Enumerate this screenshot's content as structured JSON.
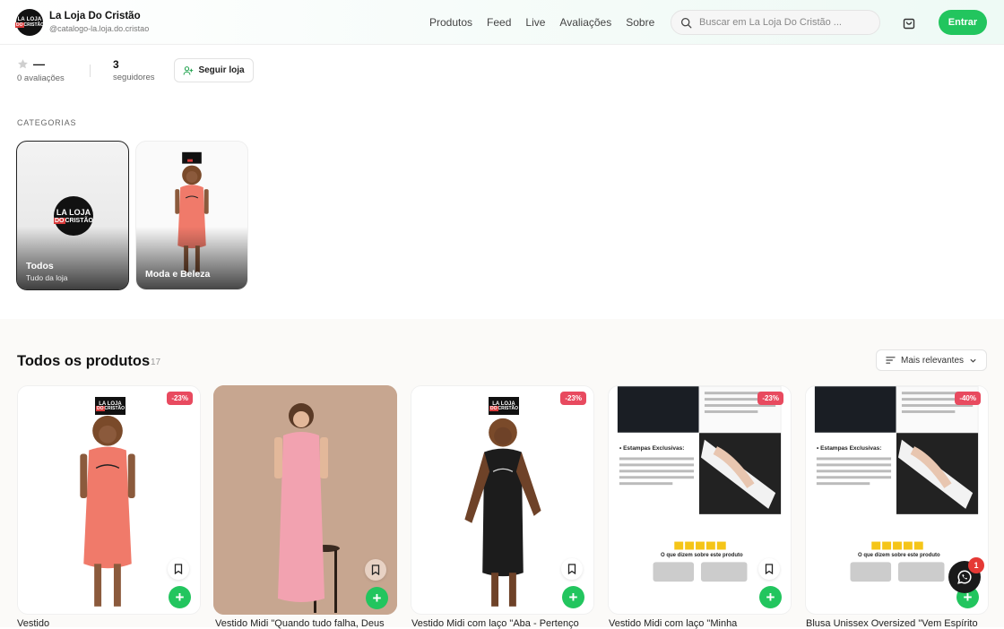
{
  "header": {
    "store_name": "La Loja Do Cristão",
    "store_handle": "@catalogo-la.loja.do.cristao",
    "logo_line1": "LA LOJA",
    "logo_line2_a": "DO",
    "logo_line2_b": "CRISTÃO",
    "nav": [
      "Produtos",
      "Feed",
      "Live",
      "Avaliações",
      "Sobre"
    ],
    "search_placeholder": "Buscar em La Loja Do Cristão ...",
    "login_label": "Entrar"
  },
  "stats": {
    "rating_value": "—",
    "rating_label": "0 avaliações",
    "followers_count": "3",
    "followers_label": "seguidores",
    "follow_button": "Seguir loja"
  },
  "categories": {
    "title": "CATEGORIAS",
    "items": [
      {
        "label": "Todos",
        "sub": "Tudo da loja"
      },
      {
        "label": "Moda e Beleza"
      }
    ]
  },
  "products": {
    "title": "Todos os produtos",
    "count": "17",
    "sort_label": "Mais relevantes",
    "items": [
      {
        "name": "Vestido",
        "discount": "-23%"
      },
      {
        "name": "Vestido Midi \"Quando tudo falha, Deus"
      },
      {
        "name": "Vestido Midi com laço \"Aba - Pertenço",
        "discount": "-23%"
      },
      {
        "name": "Vestido Midi com laço \"Minha",
        "discount": "-23%"
      },
      {
        "name": "Blusa Unissex Oversized \"Vem Espírito",
        "discount": "-40%"
      }
    ],
    "flyer_heading": "• Estampas Exclusivas:",
    "flyer_reviews": "O que dizem sobre este produto"
  },
  "chat": {
    "badge": "1"
  },
  "colors": {
    "accent": "#22c55e",
    "discount": "#e84a5f"
  }
}
